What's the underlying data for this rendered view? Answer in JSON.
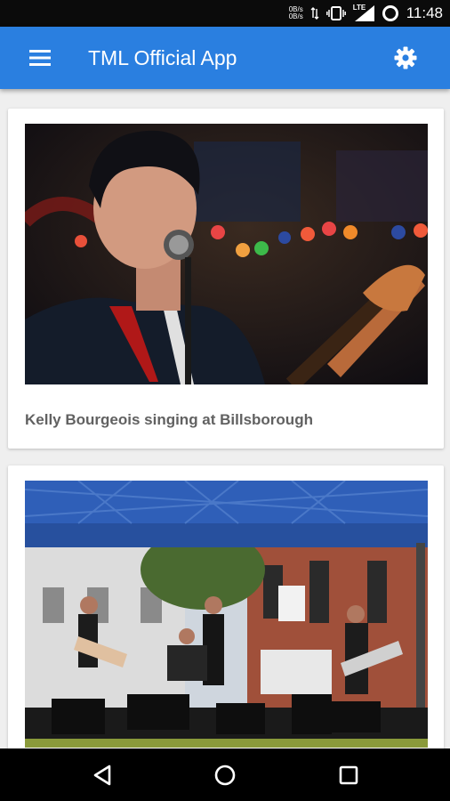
{
  "status_bar": {
    "network_top": "0B/s",
    "network_bottom": "0B/s",
    "signal_label": "LTE",
    "time": "11:48"
  },
  "app_bar": {
    "title": "TML Official App",
    "color": "#2a7fe0"
  },
  "feed": {
    "posts": [
      {
        "caption": "Kelly Bourgeois singing at Billsborough"
      },
      {
        "caption": ""
      }
    ]
  },
  "icons": {
    "menu": "hamburger-menu-icon",
    "settings": "gear-icon",
    "back": "triangle-back-icon",
    "home": "circle-home-icon",
    "recents": "square-recents-icon"
  }
}
